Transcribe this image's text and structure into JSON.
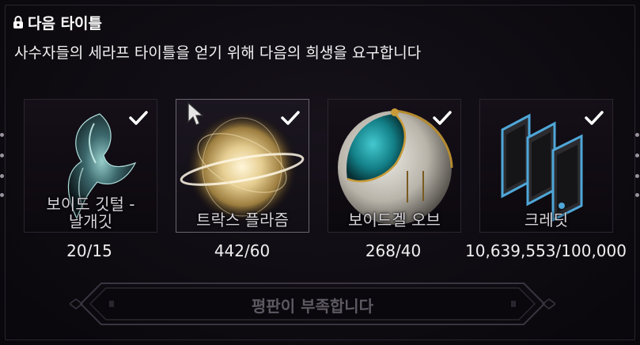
{
  "header": {
    "title": "다음 타이틀",
    "subtitle": "사수자들의 세라프 타이틀을 얻기 위해 다음의 희생을 요구합니다"
  },
  "requirements": [
    {
      "name": "보이드 깃털 - 날개깃",
      "name_line1": "보이드 깃털 -",
      "name_line2": "날개깃",
      "count": "20/15",
      "icon": "void-feather-icon",
      "checked": true
    },
    {
      "name": "트락스 플라즘",
      "count": "442/60",
      "icon": "thrax-plasm-icon",
      "checked": true
    },
    {
      "name": "보이드겔 오브",
      "count": "268/40",
      "icon": "voidgel-orb-icon",
      "checked": true
    },
    {
      "name": "크레딧",
      "count": "10,639,553/100,000",
      "icon": "credits-icon",
      "checked": true
    }
  ],
  "action": {
    "label": "평판이 부족합니다",
    "enabled": false
  },
  "colors": {
    "background": "#0d0a0f",
    "text": "#ffffff",
    "disabled_text": "#5e5862",
    "check": "#ffffff"
  }
}
